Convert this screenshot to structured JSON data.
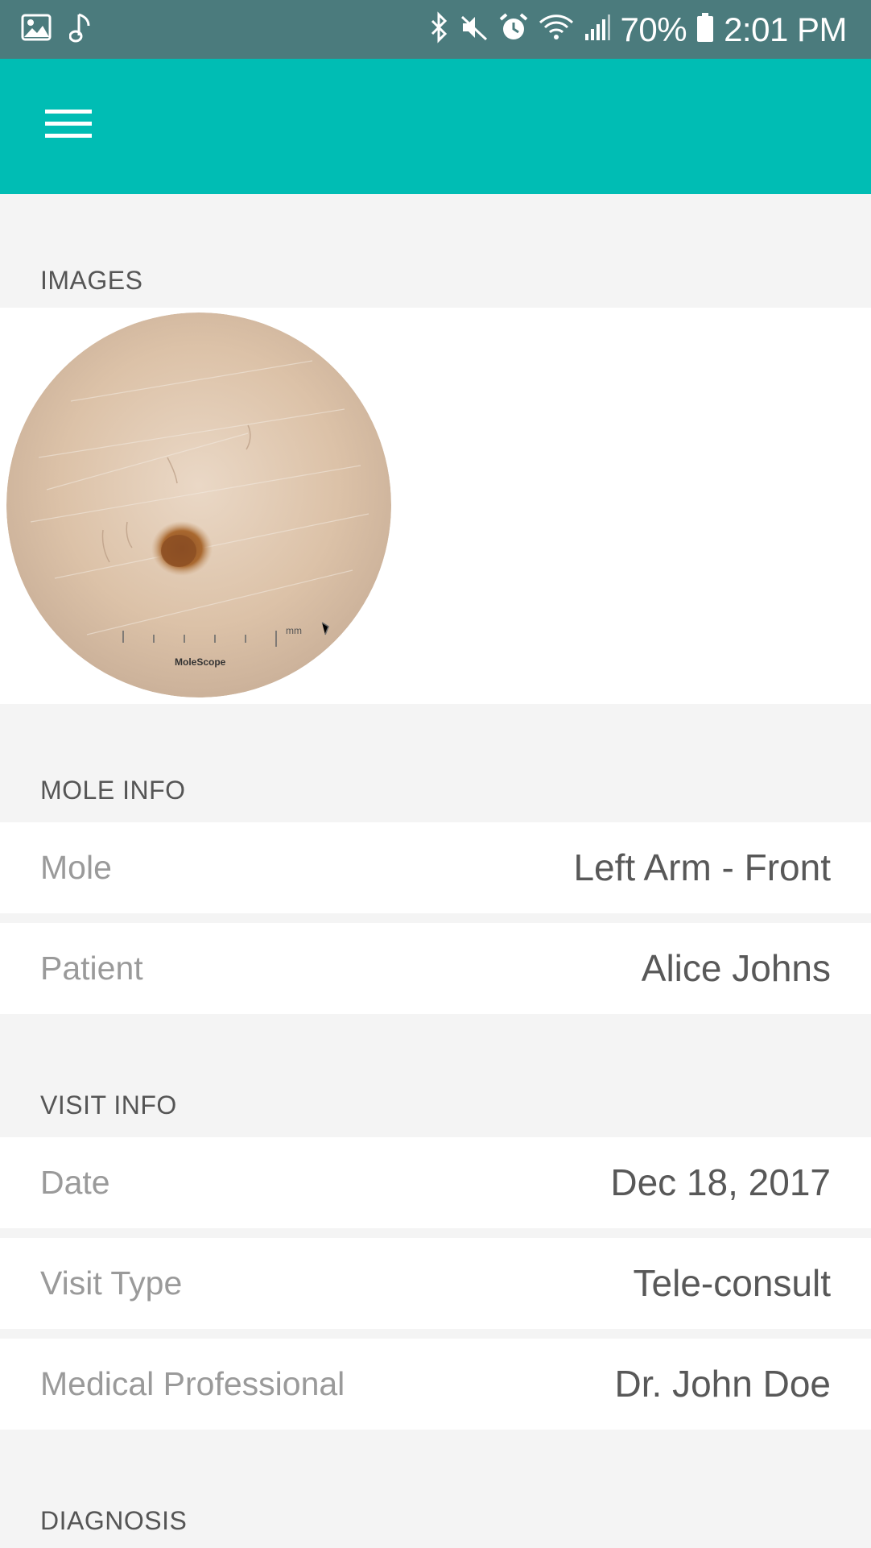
{
  "status_bar": {
    "battery": "70%",
    "time": "2:01 PM",
    "left_icons": [
      "image-icon",
      "music-note-icon"
    ],
    "right_icons": [
      "bluetooth-icon",
      "mute-icon",
      "alarm-icon",
      "wifi-icon",
      "signal-icon",
      "battery-icon"
    ]
  },
  "app_bar": {
    "menu_icon": "menu-icon",
    "color": "#00bdb4"
  },
  "sections": {
    "images": "IMAGES",
    "mole_info": "MOLE INFO",
    "visit_info": "VISIT INFO",
    "diagnosis": "DIAGNOSIS"
  },
  "image": {
    "scale_unit": "mm",
    "brand": "MoleScope"
  },
  "mole_info": {
    "rows": [
      {
        "label": "Mole",
        "value": "Left Arm - Front"
      },
      {
        "label": "Patient",
        "value": "Alice Johns"
      }
    ]
  },
  "visit_info": {
    "rows": [
      {
        "label": "Date",
        "value": "Dec 18, 2017"
      },
      {
        "label": "Visit Type",
        "value": "Tele-consult"
      },
      {
        "label": "Medical Professional",
        "value": "Dr. John Doe"
      }
    ]
  },
  "colors": {
    "status_bar": "#4b7b7d",
    "app_bar": "#00bdb4",
    "background": "#f4f4f4",
    "label": "#9a9a9a",
    "value": "#585858"
  }
}
